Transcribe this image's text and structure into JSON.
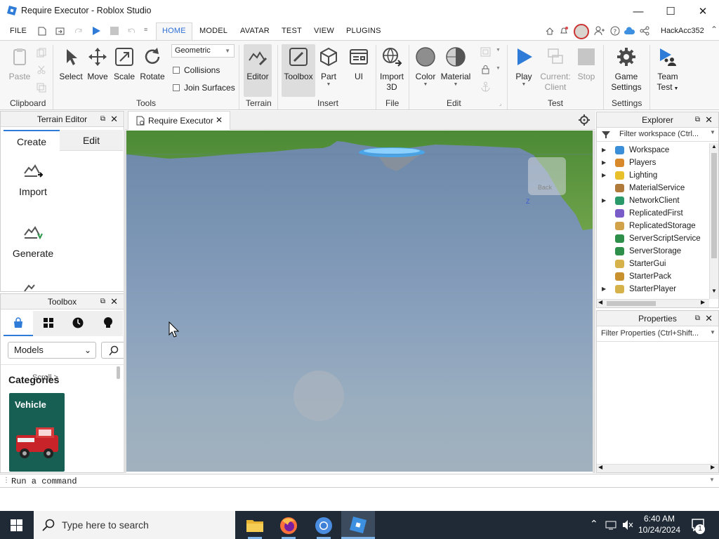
{
  "window": {
    "title": "Require Executor - Roblox Studio",
    "minimize": "—",
    "maximize": "☐",
    "close": "✕"
  },
  "menu": {
    "tabs": [
      "FILE",
      "HOME",
      "MODEL",
      "AVATAR",
      "TEST",
      "VIEW",
      "PLUGINS"
    ],
    "active": "HOME",
    "username": "HackAcc352"
  },
  "ribbon": {
    "clipboard": {
      "paste": "Paste",
      "group": "Clipboard"
    },
    "tools": {
      "select": "Select",
      "move": "Move",
      "scale": "Scale",
      "rotate": "Rotate",
      "mode": "Geometric",
      "collisions": "Collisions",
      "join_surfaces": "Join Surfaces",
      "group": "Tools"
    },
    "terrain": {
      "editor": "Editor",
      "group": "Terrain"
    },
    "insert": {
      "toolbox": "Toolbox",
      "part": "Part",
      "ui": "UI",
      "group": "Insert"
    },
    "file": {
      "import3d_line1": "Import",
      "import3d_line2": "3D",
      "group": "File"
    },
    "edit": {
      "color": "Color",
      "material": "Material",
      "group": "Edit"
    },
    "test": {
      "play": "Play",
      "current_line1": "Current:",
      "current_line2": "Client",
      "stop": "Stop",
      "group": "Test"
    },
    "settings": {
      "game_line1": "Game",
      "game_line2": "Settings",
      "group": "Settings"
    },
    "team": {
      "line1": "Team",
      "line2": "Test"
    }
  },
  "terrain_editor": {
    "title": "Terrain Editor",
    "tabs": [
      "Create",
      "Edit"
    ],
    "items": [
      "Import",
      "Generate"
    ]
  },
  "toolbox": {
    "title": "Toolbox",
    "dropdown": "Models",
    "categories_label": "Categories",
    "scroll_hint": "Scroll >",
    "card": "Vehicle"
  },
  "document_tab": {
    "title": "Require Executor"
  },
  "viewport": {
    "cube_label": "Back",
    "axis_label": "Z"
  },
  "explorer": {
    "title": "Explorer",
    "filter_placeholder": "Filter workspace (Ctrl...",
    "items": [
      {
        "label": "Workspace",
        "expandable": true,
        "color": "#3a8fd8"
      },
      {
        "label": "Players",
        "expandable": true,
        "color": "#d88a2b"
      },
      {
        "label": "Lighting",
        "expandable": true,
        "color": "#e8c02a"
      },
      {
        "label": "MaterialService",
        "expandable": false,
        "color": "#b07a3a"
      },
      {
        "label": "NetworkClient",
        "expandable": true,
        "color": "#2b9a6a"
      },
      {
        "label": "ReplicatedFirst",
        "expandable": false,
        "color": "#7a5cc8"
      },
      {
        "label": "ReplicatedStorage",
        "expandable": false,
        "color": "#d2a24a"
      },
      {
        "label": "ServerScriptService",
        "expandable": false,
        "color": "#2e8f4a"
      },
      {
        "label": "ServerStorage",
        "expandable": false,
        "color": "#2e8f4a"
      },
      {
        "label": "StarterGui",
        "expandable": false,
        "color": "#d6b24a"
      },
      {
        "label": "StarterPack",
        "expandable": false,
        "color": "#c9902e"
      },
      {
        "label": "StarterPlayer",
        "expandable": true,
        "color": "#d6b24a"
      }
    ]
  },
  "properties": {
    "title": "Properties",
    "filter_placeholder": "Filter Properties (Ctrl+Shift..."
  },
  "command_bar": {
    "placeholder": "Run a command"
  },
  "taskbar": {
    "search_placeholder": "Type here to search",
    "time": "6:40 AM",
    "date": "10/24/2024",
    "notification_count": "1"
  }
}
